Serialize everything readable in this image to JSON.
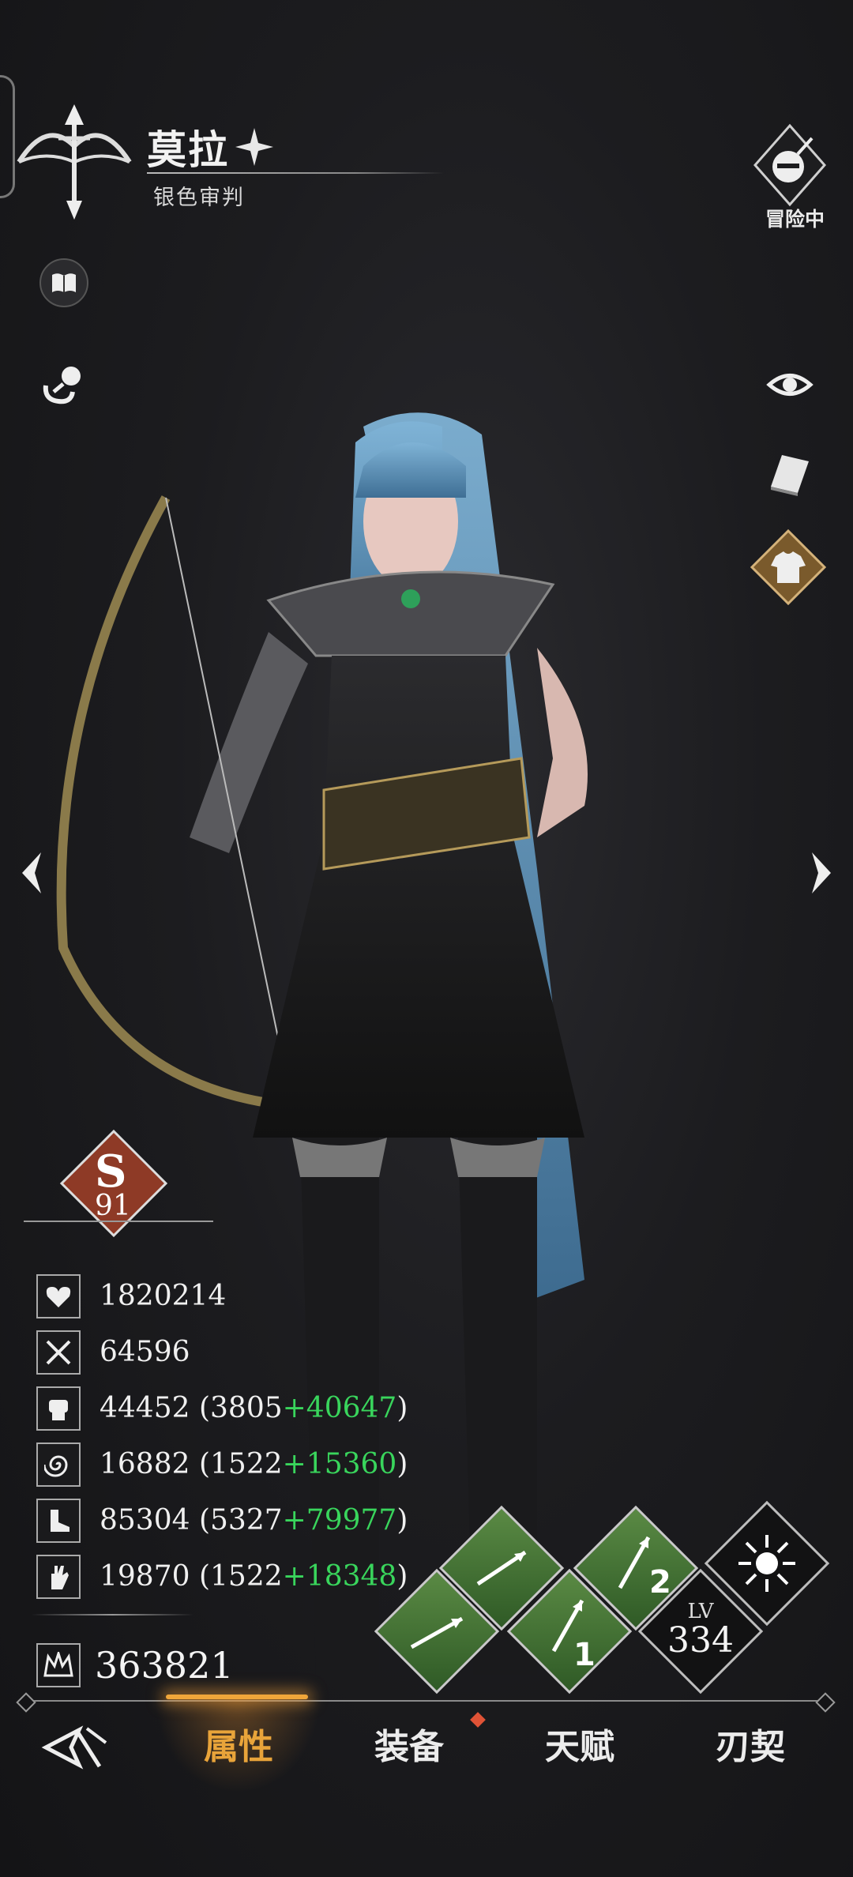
{
  "character": {
    "name": "莫拉",
    "title": "银色审判",
    "status": "冒险中"
  },
  "rank": {
    "grade": "S",
    "level": "91"
  },
  "stats": [
    {
      "icon": "heart-icon",
      "text": "1820214",
      "base": "",
      "plus": "",
      "close": ""
    },
    {
      "icon": "crossed-swords-icon",
      "text": "64596",
      "base": "",
      "plus": "",
      "close": ""
    },
    {
      "icon": "fist-icon",
      "text": "44452",
      "base": " (3805",
      "plus": "+40647",
      "close": ")"
    },
    {
      "icon": "spiral-icon",
      "text": "16882",
      "base": " (1522",
      "plus": "+15360",
      "close": ")"
    },
    {
      "icon": "boot-icon",
      "text": "85304",
      "base": " (5327",
      "plus": "+79977",
      "close": ")"
    },
    {
      "icon": "hand-icon",
      "text": "19870",
      "base": " (1522",
      "plus": "+18348",
      "close": ")"
    }
  ],
  "power": {
    "icon": "crown-icon",
    "value": "363821"
  },
  "skills": {
    "slot1_number": "1",
    "slot2_number": "2",
    "lv_label": "LV",
    "lv_value": "334"
  },
  "nav": {
    "tabs": [
      "属性",
      "装备",
      "天赋",
      "刃契"
    ],
    "active": 0
  },
  "colors": {
    "accent": "#e9a43a",
    "plus_green": "#39d55c",
    "skill_green": "#4b7a3a",
    "rank_red": "#8e3a26"
  }
}
